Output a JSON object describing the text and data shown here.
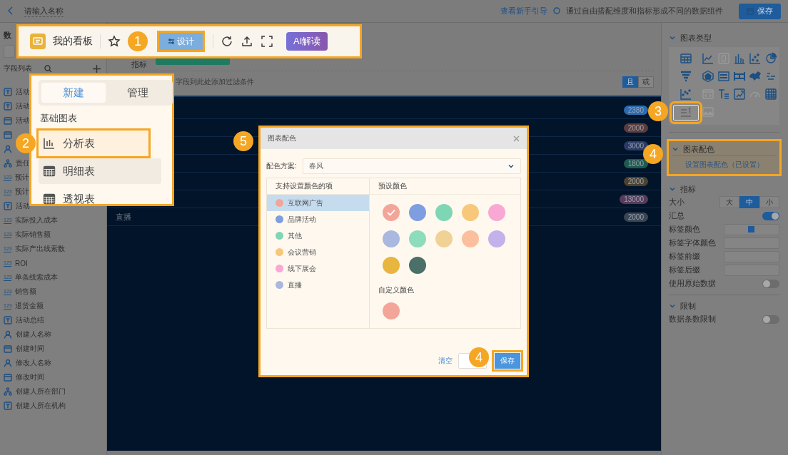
{
  "topbar": {
    "title": "请输入名称",
    "guide_link": "查看新手引导",
    "hint": "通过自由搭配维度和指标形成不同的数据组件",
    "save": "保存"
  },
  "sidebar": {
    "data_label": "数",
    "fields_title": "字段列表",
    "fields": [
      {
        "kind": "text",
        "label": "活动"
      },
      {
        "kind": "text",
        "label": "活动"
      },
      {
        "kind": "date",
        "label": "活动"
      },
      {
        "kind": "date"
      },
      {
        "kind": "person"
      },
      {
        "kind": "org",
        "label": "责任"
      },
      {
        "kind": "number",
        "icon_text": "123",
        "label": "预计"
      },
      {
        "kind": "number",
        "icon_text": "123",
        "label": "预计"
      },
      {
        "kind": "text",
        "label": "活动"
      },
      {
        "kind": "number",
        "icon_text": "123",
        "label": "实际投入成本"
      },
      {
        "kind": "number",
        "icon_text": "123",
        "label": "实际销售额"
      },
      {
        "kind": "number",
        "icon_text": "123",
        "label": "实际产出线索数"
      },
      {
        "kind": "number",
        "icon_text": "123",
        "label": "ROI"
      },
      {
        "kind": "number",
        "icon_text": "123",
        "label": "单条线索成本"
      },
      {
        "kind": "number",
        "icon_text": "123",
        "label": "销售额"
      },
      {
        "kind": "number",
        "icon_text": "123",
        "label": "退货金额"
      },
      {
        "kind": "text",
        "label": "活动总结"
      },
      {
        "kind": "person",
        "label": "创建人名称"
      },
      {
        "kind": "date",
        "label": "创建时间"
      },
      {
        "kind": "person",
        "label": "修改人名称"
      },
      {
        "kind": "date",
        "label": "修改时间"
      },
      {
        "kind": "org",
        "label": "创建人所在部门"
      },
      {
        "kind": "text",
        "label": "创建人所在机构"
      }
    ]
  },
  "config": {
    "metric_label": "指标",
    "filter_hint": "字段到此处添加过滤条件",
    "logic": [
      {
        "label": "且",
        "selected": true
      },
      {
        "label": "或",
        "selected": false
      }
    ]
  },
  "table": {
    "rows": [
      {
        "value": "2380",
        "color": "#2c6bb0"
      },
      {
        "value": "2000",
        "color": "#5b3b3e"
      },
      {
        "value": "3000",
        "color": "#2b3a66"
      },
      {
        "value": "1800",
        "color": "#1e5a50"
      },
      {
        "value": "2000",
        "color": "#4c4230"
      },
      {
        "value": "13000",
        "color": "#573a5c"
      },
      {
        "label": "直播",
        "value": "2000",
        "color": "#3a4656"
      }
    ]
  },
  "right_panel": {
    "chart_types": {
      "title": "图表类型",
      "items": [
        {
          "kind": "table",
          "disabled": false,
          "selected": false
        },
        {
          "kind": "line",
          "disabled": false,
          "selected": false
        },
        {
          "kind": "number",
          "disabled": true,
          "selected": false
        },
        {
          "kind": "column",
          "disabled": false,
          "selected": false
        },
        {
          "kind": "scatter",
          "disabled": false,
          "selected": false
        },
        {
          "kind": "pie",
          "disabled": false,
          "selected": false
        },
        {
          "kind": "funnel",
          "disabled": false,
          "selected": false
        },
        {
          "kind": "radar",
          "disabled": false,
          "selected": false
        },
        {
          "kind": "strip",
          "disabled": false,
          "selected": false
        },
        {
          "kind": "flow",
          "disabled": false,
          "selected": false
        },
        {
          "kind": "map",
          "disabled": false,
          "selected": false
        },
        {
          "kind": "wordcloud",
          "disabled": false,
          "selected": false
        },
        {
          "kind": "dots",
          "disabled": false,
          "selected": false
        },
        {
          "kind": "code",
          "disabled": true,
          "selected": false
        },
        {
          "kind": "text",
          "disabled": false,
          "selected": false
        },
        {
          "kind": "frame",
          "disabled": false,
          "selected": false
        },
        {
          "kind": "gauge",
          "disabled": true,
          "selected": false
        },
        {
          "kind": "grid",
          "disabled": false,
          "selected": false
        },
        {
          "kind": "ranking",
          "disabled": false,
          "selected": true,
          "callout": "3"
        },
        {
          "kind": "image",
          "disabled": true,
          "selected": false
        }
      ]
    },
    "color": {
      "title": "图表配色",
      "button": "设置图表配色（已设置）",
      "callout": "4"
    },
    "metrics": {
      "title": "指标",
      "size_label": "大小",
      "sizes": [
        {
          "label": "大",
          "selected": false
        },
        {
          "label": "中",
          "selected": true
        },
        {
          "label": "小",
          "selected": false
        }
      ],
      "rows": [
        {
          "kind": "toggle",
          "label": "汇总",
          "on": true
        },
        {
          "kind": "swatch",
          "label": "标签颜色",
          "color": "#1f5a99"
        },
        {
          "kind": "swatch",
          "label": "标签字体颜色"
        },
        {
          "kind": "input",
          "label": "标签前缀"
        },
        {
          "kind": "input",
          "label": "标签后缀"
        },
        {
          "kind": "toggle",
          "label": "使用原始数据",
          "on": false
        }
      ]
    },
    "limit": {
      "title": "限制",
      "rows": [
        {
          "kind": "toggle",
          "label": "数据条数限制",
          "on": false
        }
      ]
    }
  },
  "toolbar": {
    "board_name": "我的看板",
    "design": "设计",
    "design_callout": "1",
    "ai": "AI解读"
  },
  "new_menu": {
    "tabs": [
      {
        "label": "新建",
        "selected": true
      },
      {
        "label": "管理",
        "selected": false
      }
    ],
    "section": "基础图表",
    "items": [
      {
        "kind": "analysis",
        "label": "分析表",
        "highlighted": false,
        "callout": "2"
      },
      {
        "kind": "detail",
        "label": "明细表",
        "highlighted": true
      },
      {
        "kind": "pivot",
        "label": "透视表",
        "highlighted": false
      }
    ]
  },
  "dialog": {
    "title": "图表配色",
    "callout": "5",
    "scheme_label": "配色方案:",
    "scheme": "春风",
    "items_header": "支持设置颜色的项",
    "items": [
      {
        "label": "互联网广告",
        "color": "#f4a59a",
        "selected": true
      },
      {
        "label": "品牌活动",
        "color": "#7f9ee0",
        "selected": false
      },
      {
        "label": "其他",
        "color": "#7fd6b5",
        "selected": false
      },
      {
        "label": "会议营销",
        "color": "#f7c77a",
        "selected": false
      },
      {
        "label": "线下展会",
        "color": "#f9a8d4",
        "selected": false
      },
      {
        "label": "直播",
        "color": "#a9b8de",
        "selected": false
      }
    ],
    "preset_title": "预设颜色",
    "presets": [
      {
        "color": "#f4a59a",
        "checked": true
      },
      {
        "color": "#7f9ee0",
        "checked": false
      },
      {
        "color": "#7fd6b5",
        "checked": false
      },
      {
        "color": "#f7c77a",
        "checked": false
      },
      {
        "color": "#f9a8d4",
        "checked": false
      },
      {
        "color": "#a9b8de",
        "checked": false
      },
      {
        "color": "#8ddcbb",
        "checked": false
      },
      {
        "color": "#f0d296",
        "checked": false
      },
      {
        "color": "#fbbf9d",
        "checked": false
      },
      {
        "color": "#c4b0ea",
        "checked": false
      },
      {
        "color": "#e8b53e",
        "checked": false
      },
      {
        "color": "#4a7068",
        "checked": false
      }
    ],
    "custom_title": "自定义颜色",
    "custom": [
      {
        "color": "#f4a59a"
      }
    ],
    "clear": "清空",
    "save": "保存",
    "save_callout": "4"
  }
}
